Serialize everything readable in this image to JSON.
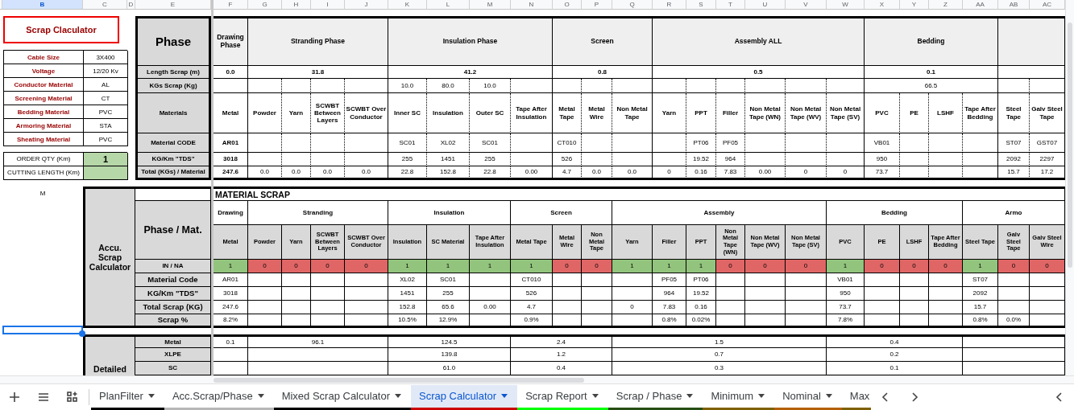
{
  "column_headers": [
    {
      "label": "B",
      "selected": true
    },
    {
      "label": "C",
      "selected": false
    },
    {
      "label": "D",
      "selected": false
    },
    {
      "label": "E",
      "selected": false
    },
    {
      "label": "F",
      "selected": false
    },
    {
      "label": "G",
      "selected": false
    },
    {
      "label": "H",
      "selected": false
    },
    {
      "label": "I",
      "selected": false
    },
    {
      "label": "J",
      "selected": false
    },
    {
      "label": "K",
      "selected": false
    },
    {
      "label": "L",
      "selected": false
    },
    {
      "label": "M",
      "selected": false
    },
    {
      "label": "N",
      "selected": false
    },
    {
      "label": "O",
      "selected": false
    },
    {
      "label": "P",
      "selected": false
    },
    {
      "label": "Q",
      "selected": false
    },
    {
      "label": "R",
      "selected": false
    },
    {
      "label": "S",
      "selected": false
    },
    {
      "label": "T",
      "selected": false
    },
    {
      "label": "U",
      "selected": false
    },
    {
      "label": "V",
      "selected": false
    },
    {
      "label": "W",
      "selected": false
    },
    {
      "label": "X",
      "selected": false
    },
    {
      "label": "Y",
      "selected": false
    },
    {
      "label": "Z",
      "selected": false
    },
    {
      "label": "AA",
      "selected": false
    },
    {
      "label": "AB",
      "selected": false
    },
    {
      "label": "AC",
      "selected": false
    }
  ],
  "calculator": {
    "title": "Scrap Claculator",
    "parameters": [
      {
        "label": "Cable Size",
        "value": "3X400"
      },
      {
        "label": "Voltage",
        "value": "12/20 Kv"
      },
      {
        "label": "Conductor Material",
        "value": "AL"
      },
      {
        "label": "Screening Material",
        "value": "CT"
      },
      {
        "label": "Bedding Material",
        "value": "PVC"
      },
      {
        "label": "Armoring Material",
        "value": "STA"
      },
      {
        "label": "Sheating Material",
        "value": "PVC"
      }
    ],
    "order_qty": {
      "label": "ORDER QTY (Km)",
      "value": "1"
    },
    "cutting_length": {
      "label": "CUTTING LENGTH (Km)"
    }
  },
  "phase_table": {
    "corner": "Phase",
    "row_labels": [
      "Length Scrap (m)",
      "KGs Scrap (Kg)",
      "Materials",
      "Material CODE",
      "KG/Km \"TDS\"",
      "Total (KGs) / Material"
    ],
    "phases": [
      {
        "name": "Drawing Phase",
        "length_scrap": "0.0",
        "materials": [
          {
            "name": "Metal",
            "code": "AR01",
            "tds": "3018",
            "total": "247.6",
            "emphasized": true
          }
        ]
      },
      {
        "name": "Stranding Phase",
        "length_scrap": "31.8",
        "materials": [
          {
            "name": "Powder",
            "total": "0.0",
            "emphasized": false
          },
          {
            "name": "Yarn",
            "total": "0.0",
            "emphasized": false
          },
          {
            "name": "SCWBT Between Layers",
            "total": "0.0",
            "emphasized": false
          },
          {
            "name": "SCWBT Over Conductor",
            "total": "0.0",
            "emphasized": false
          }
        ]
      },
      {
        "name": "Insulation Phase",
        "length_scrap": "41.2",
        "materials": [
          {
            "name": "Inner SC",
            "kgs_scrap": "10.0",
            "code": "SC01",
            "tds": "255",
            "total": "22.8",
            "emphasized": false
          },
          {
            "name": "Insulation",
            "kgs_scrap": "80.0",
            "code": "XL02",
            "tds": "1451",
            "total": "152.8",
            "emphasized": false
          },
          {
            "name": "Outer SC",
            "kgs_scrap": "10.0",
            "code": "SC01",
            "tds": "255",
            "total": "22.8",
            "emphasized": false
          },
          {
            "name": "Tape After Insulation",
            "total": "0.00",
            "emphasized": false
          }
        ]
      },
      {
        "name": "Screen",
        "length_scrap": "0.8",
        "materials": [
          {
            "name": "Metal Tape",
            "code": "CT010",
            "tds": "526",
            "total": "4.7",
            "emphasized": false
          },
          {
            "name": "Metal Wire",
            "total": "0.0",
            "emphasized": false
          },
          {
            "name": "Non Metal Tape",
            "total": "0.0",
            "emphasized": false
          }
        ]
      },
      {
        "name": "Assembly ALL",
        "length_scrap": "0.5",
        "materials": [
          {
            "name": "Yarn",
            "total": "0",
            "emphasized": false
          },
          {
            "name": "PPT",
            "code": "PT06",
            "tds": "19.52",
            "total": "0.16",
            "emphasized": false
          },
          {
            "name": "Filler",
            "code": "PF05",
            "tds": "964",
            "total": "7.83",
            "emphasized": false
          },
          {
            "name": "Non Metal Tape (WN)",
            "total": "0.00",
            "emphasized": false
          },
          {
            "name": "Non Metal Tape (WV)",
            "total": "0",
            "emphasized": false
          },
          {
            "name": "Non Metal Tape (SV)",
            "total": "0",
            "emphasized": false
          }
        ]
      },
      {
        "name": "Bedding",
        "length_scrap": "0.1",
        "kgs_scrap": "66.5",
        "materials": [
          {
            "name": "PVC",
            "code": "VB01",
            "tds": "950",
            "total": "73.7",
            "emphasized": false
          },
          {
            "name": "PE"
          },
          {
            "name": "LSHF"
          },
          {
            "name": "Tape After Bedding"
          }
        ]
      },
      {
        "materials": [
          {
            "name": "Steel Tape",
            "code": "ST07",
            "tds": "2092",
            "total": "15.7",
            "emphasized": false
          },
          {
            "name": "Galv Steel Tape",
            "code": "GST07",
            "tds": "2297",
            "total": "17.2",
            "emphasized": false
          }
        ]
      }
    ]
  },
  "material_scrap": {
    "side_note": "M",
    "side_title": "Accu. Scrap Calculator",
    "corner": "Phase / Mat.",
    "title": "MATERIAL SCRAP",
    "row_labels": [
      "IN / NA",
      "Material Code",
      "KG/Km \"TDS\"",
      "Total Scrap (KG)",
      "Scrap %"
    ],
    "phases": [
      {
        "name": "Drawing",
        "detailed": [
          "0.1"
        ],
        "materials": [
          {
            "name": "Metal",
            "in_na": "1",
            "included": true,
            "code": "AR01",
            "tds": "3018",
            "total": "247.6",
            "scrap_pct": "8.2%"
          }
        ]
      },
      {
        "name": "Stranding",
        "detailed": [
          "96.1"
        ],
        "materials": [
          {
            "name": "Powder",
            "in_na": "0",
            "included": false
          },
          {
            "name": "Yarn",
            "in_na": "0",
            "included": false
          },
          {
            "name": "SCWBT Between Layers",
            "in_na": "0",
            "included": false
          },
          {
            "name": "SCWBT Over Conductor",
            "in_na": "0",
            "included": false
          }
        ]
      },
      {
        "name": "Insulation",
        "detailed": [
          "124.5",
          "139.8",
          "61.0"
        ],
        "materials": [
          {
            "name": "Insulation",
            "in_na": "1",
            "included": true,
            "code": "XL02",
            "tds": "1451",
            "total": "152.8",
            "scrap_pct": "10.5%"
          },
          {
            "name": "SC Material",
            "in_na": "1",
            "included": true,
            "code": "SC01",
            "tds": "255",
            "total": "65.6",
            "scrap_pct": "12.9%"
          },
          {
            "name": "Tape After Insulation",
            "in_na": "1",
            "included": true,
            "total": "0.00"
          }
        ]
      },
      {
        "name": "Screen",
        "detailed": [
          "2.4",
          "1.2",
          "0.4"
        ],
        "materials": [
          {
            "name": "Metal Tape",
            "in_na": "1",
            "included": true,
            "code": "CT010",
            "tds": "526",
            "total": "4.7",
            "scrap_pct": "0.9%"
          },
          {
            "name": "Metal Wire",
            "in_na": "0",
            "included": false
          },
          {
            "name": "Non Metal Tape",
            "in_na": "0",
            "included": false
          }
        ]
      },
      {
        "name": "Assembly",
        "detailed": [
          "1.5",
          "0.7",
          "0.3"
        ],
        "materials": [
          {
            "name": "Yarn",
            "in_na": "1",
            "included": true,
            "total": "0"
          },
          {
            "name": "Filler",
            "in_na": "1",
            "included": true,
            "code": "PF05",
            "tds": "964",
            "total": "7.83",
            "scrap_pct": "0.8%"
          },
          {
            "name": "PPT",
            "in_na": "1",
            "included": true,
            "code": "PT06",
            "tds": "19.52",
            "total": "0.16",
            "scrap_pct": "0.02%"
          },
          {
            "name": "Non Metal Tape (WN)",
            "in_na": "0",
            "included": false
          },
          {
            "name": "Non Metal Tape (WV)",
            "in_na": "0",
            "included": false
          },
          {
            "name": "Non Metal Tape (SV)",
            "in_na": "0",
            "included": false
          }
        ]
      },
      {
        "name": "Bedding",
        "detailed": [
          "0.4",
          "0.2",
          "0.1"
        ],
        "materials": [
          {
            "name": "PVC",
            "in_na": "1",
            "included": true,
            "code": "VB01",
            "tds": "950",
            "total": "73.7",
            "scrap_pct": "7.8%"
          },
          {
            "name": "PE",
            "in_na": "0",
            "included": false
          },
          {
            "name": "LSHF",
            "in_na": "0",
            "included": false
          },
          {
            "name": "Tape After Bedding",
            "in_na": "0",
            "included": false
          }
        ]
      },
      {
        "name": "Armo",
        "materials": [
          {
            "name": "Steel Tape",
            "in_na": "1",
            "included": true,
            "code": "ST07",
            "tds": "2092",
            "total": "15.7",
            "scrap_pct": "0.8%"
          },
          {
            "name": "Galv Steel Tape",
            "in_na": "0",
            "included": false,
            "scrap_pct": "0.0%"
          },
          {
            "name": "Galv Steel Wire",
            "in_na": "0",
            "included": false
          }
        ]
      }
    ]
  },
  "detailed": {
    "title": "Detailed",
    "row_labels": [
      "Metal",
      "XLPE",
      "SC"
    ]
  },
  "sheet_tabs": [
    {
      "label": "PlanFilter",
      "selected": false,
      "color": "#000000"
    },
    {
      "label": "Acc.Scrap/Phase",
      "selected": false,
      "color": "#b7b7b7"
    },
    {
      "label": "Mixed Scrap Calculator",
      "selected": false,
      "color": "#000000"
    },
    {
      "label": "Scrap Calculator",
      "selected": true,
      "color": "#cc0000"
    },
    {
      "label": "Scrap Report",
      "selected": false,
      "color": "#00ff00"
    },
    {
      "label": "Scrap / Phase",
      "selected": false,
      "color": "#274e13"
    },
    {
      "label": "Minimum",
      "selected": false,
      "color": "#7f6000"
    },
    {
      "label": "Nominal",
      "selected": false,
      "color": "#b45f06"
    },
    {
      "label": "Max",
      "selected": false,
      "color": "#7f6000"
    }
  ]
}
